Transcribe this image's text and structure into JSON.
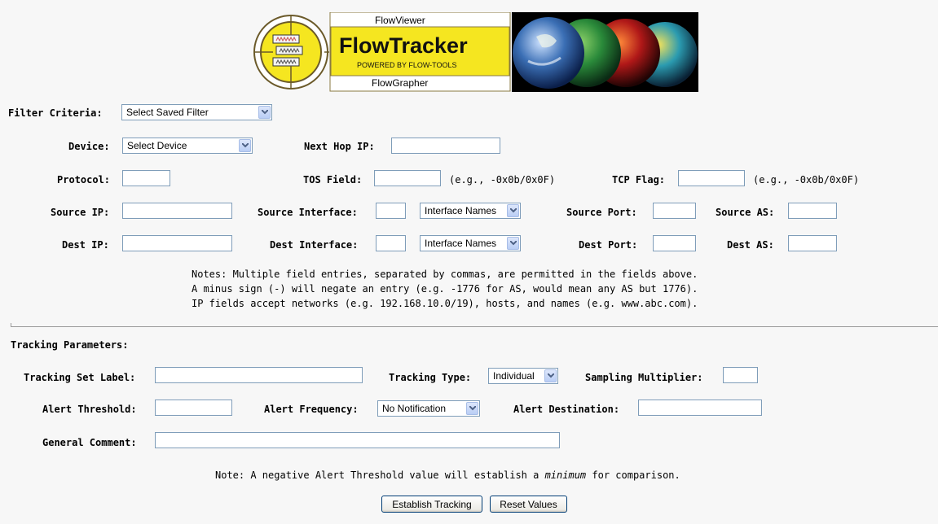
{
  "header": {
    "logo_top": "FlowViewer",
    "logo_title": "FlowTracker",
    "logo_subtitle": "POWERED BY FLOW-TOOLS",
    "logo_bottom": "FlowGrapher"
  },
  "filter": {
    "criteria_label": "Filter Criteria:",
    "criteria_value": "Select Saved Filter",
    "device_label": "Device:",
    "device_value": "Select Device",
    "next_hop_label": "Next Hop IP:",
    "protocol_label": "Protocol:",
    "tos_label": "TOS Field:",
    "tos_hint": "(e.g., -0x0b/0x0F)",
    "tcp_label": "TCP Flag:",
    "tcp_hint": "(e.g., -0x0b/0x0F)",
    "source_ip_label": "Source IP:",
    "source_iface_label": "Source Interface:",
    "source_iface_names": "Interface Names",
    "source_port_label": "Source Port:",
    "source_as_label": "Source AS:",
    "dest_ip_label": "Dest IP:",
    "dest_iface_label": "Dest Interface:",
    "dest_iface_names": "Interface Names",
    "dest_port_label": "Dest Port:",
    "dest_as_label": "Dest AS:",
    "notes": [
      "Notes: Multiple field entries, separated by commas, are permitted in the fields above.",
      "A minus sign (-) will negate an entry (e.g. -1776 for AS, would mean any AS but 1776).",
      "IP fields accept networks (e.g. 192.168.10.0/19), hosts, and names (e.g. www.abc.com)."
    ]
  },
  "tracking": {
    "section_label": "Tracking Parameters:",
    "set_label": "Tracking Set Label:",
    "type_label": "Tracking Type:",
    "type_value": "Individual",
    "sampling_label": "Sampling Multiplier:",
    "threshold_label": "Alert Threshold:",
    "frequency_label": "Alert Frequency:",
    "frequency_value": "No Notification",
    "destination_label": "Alert Destination:",
    "comment_label": "General Comment:",
    "note_before": "Note: A negative Alert Threshold value will establish a ",
    "note_emph": "minimum",
    "note_after": " for comparison.",
    "establish_button": "Establish Tracking",
    "reset_button": "Reset Values"
  }
}
